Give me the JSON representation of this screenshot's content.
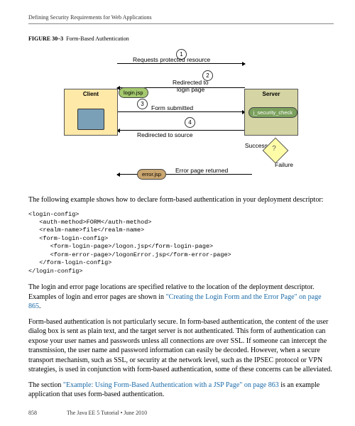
{
  "header": {
    "title": "Defining Security Requirements for Web Applications"
  },
  "figure": {
    "prefix": "FIGURE 30–3",
    "caption": "Form-Based Authentication",
    "steps": {
      "s1": "1",
      "s2": "2",
      "s3": "3",
      "s4": "4"
    },
    "labels": {
      "client": "Client",
      "server": "Server",
      "loginjsp": "login.jsp",
      "errorjsp": "error.jsp",
      "jseccheck": "j_security_check",
      "req": "Requests protected resource",
      "redir_login_a": "Redirected to",
      "redir_login_b": "login page",
      "form_sub": "Form submitted",
      "redir_src": "Redirected to source",
      "errpage": "Error page returned",
      "success": "Success",
      "failure": "Failure",
      "question": "?"
    }
  },
  "para1": "The following example shows how to declare form-based authentication in your deployment descriptor:",
  "codeblock": "<login-config>\n   <auth-method>FORM</auth-method>\n   <realm-name>file</realm-name>\n   <form-login-config>\n      <form-login-page>/logon.jsp</form-login-page>\n      <form-error-page>/logonError.jsp</form-error-page>\n   </form-login-config>\n</login-config>",
  "para2a": "The login and error page locations are specified relative to the location of the deployment descriptor. Examples of login and error pages are shown in ",
  "para2link": "\"Creating the Login Form and the Error Page\" on page 865",
  "para2b": ".",
  "para3": "Form-based authentication is not particularly secure. In form-based authentication, the content of the user dialog box is sent as plain text, and the target server is not authenticated. This form of authentication can expose your user names and passwords unless all connections are over SSL. If someone can intercept the transmission, the user name and password information can easily be decoded. However, when a secure transport mechanism, such as SSL, or security at the network level, such as the IPSEC protocol or VPN strategies, is used in conjunction with form-based authentication, some of these concerns can be alleviated.",
  "para4a": "The section ",
  "para4link": "\"Example: Using Form-Based Authentication with a JSP Page\" on page 863",
  "para4b": " is an example application that uses form-based authentication.",
  "footer": {
    "pnum": "858",
    "book": "The Java EE 5 Tutorial  •  June 2010"
  }
}
